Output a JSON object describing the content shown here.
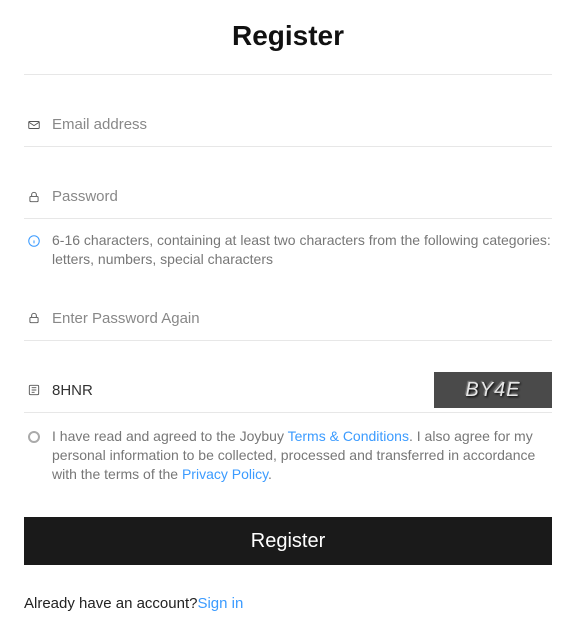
{
  "title": "Register",
  "email": {
    "placeholder": "Email address",
    "value": ""
  },
  "password": {
    "placeholder": "Password",
    "value": ""
  },
  "password_hint": "6-16 characters, containing at least two characters from the following categories: letters, numbers, special characters",
  "password2": {
    "placeholder": "Enter Password Again",
    "value": ""
  },
  "captcha": {
    "value": "8HNR",
    "image_text": "BY4E"
  },
  "terms": {
    "pre": "I have read and agreed to the Joybuy ",
    "tc_label": "Terms & Conditions",
    "mid": ". I also agree for my personal information to be collected, processed and transferred in accordance with the terms of the ",
    "pp_label": "Privacy Policy",
    "post": "."
  },
  "submit_label": "Register",
  "signin": {
    "prompt": "Already have an account?",
    "link": "Sign in"
  }
}
